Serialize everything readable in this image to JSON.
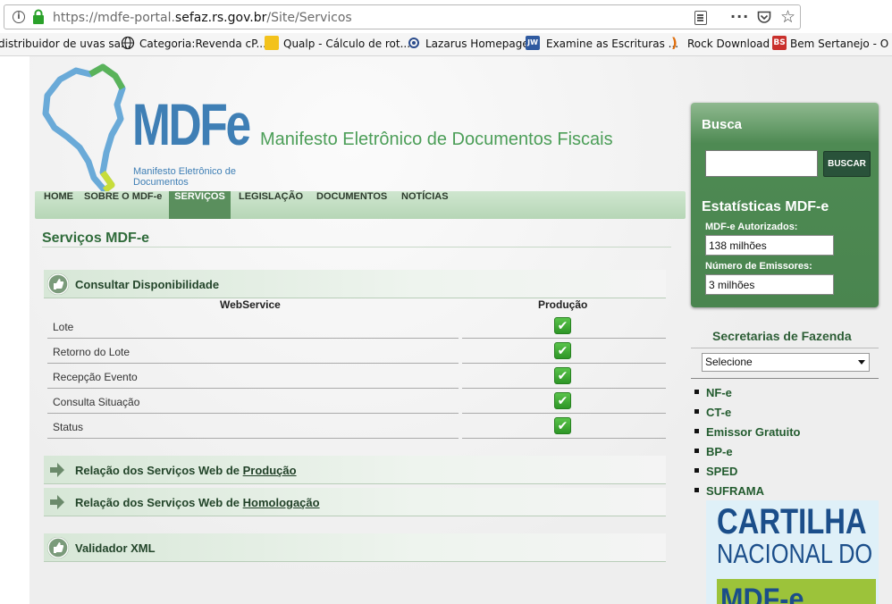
{
  "browser": {
    "url_scheme": "https://mdfe-portal.",
    "url_host": "sefaz.rs.gov.br",
    "url_path": "/Site/Servicos",
    "bookmarks": [
      {
        "label": "distribuidor de uvas sa..."
      },
      {
        "label": "Categoria:Revenda cP..."
      },
      {
        "label": "Qualp - Cálculo de rot..."
      },
      {
        "label": "Lazarus Homepage"
      },
      {
        "label": "Examine as Escrituras ..."
      },
      {
        "label": "Rock Download"
      },
      {
        "label": "Bem Sertanejo - O Me"
      }
    ]
  },
  "header": {
    "logo_text": "MDFe",
    "logo_subtitle": "Manifesto Eletrônico de Documentos",
    "site_title": "Manifesto Eletrônico de Documentos Fiscais"
  },
  "nav": {
    "items": [
      {
        "label": "HOME"
      },
      {
        "label": "SOBRE O MDF-e"
      },
      {
        "label": "SERVIÇOS"
      },
      {
        "label": "LEGISLAÇÃO"
      },
      {
        "label": "DOCUMENTOS"
      },
      {
        "label": "NOTÍCIAS"
      }
    ],
    "active": "SERVIÇOS"
  },
  "main": {
    "heading": "Serviços MDF-e",
    "availability": {
      "title": "Consultar Disponibilidade",
      "col_webservice": "WebService",
      "col_producao": "Produção",
      "rows": [
        {
          "name": "Lote",
          "status": "ok"
        },
        {
          "name": "Retorno do Lote",
          "status": "ok"
        },
        {
          "name": "Recepção Evento",
          "status": "ok"
        },
        {
          "name": "Consulta Situação",
          "status": "ok"
        },
        {
          "name": "Status",
          "status": "ok"
        }
      ]
    },
    "prod_link_prefix": "Relação dos Serviços Web de ",
    "prod_link_text": "Produção",
    "homolog_link_prefix": "Relação dos Serviços Web de ",
    "homolog_link_text": "Homologação",
    "validator_title": "Validador XML"
  },
  "sidebar": {
    "search_label": "Busca",
    "search_value": "",
    "search_button": "BUSCAR",
    "stats_title": "Estatísticas MDF-e",
    "authorized_label": "MDF-e Autorizados:",
    "authorized_value": "138 milhões",
    "emitters_label": "Número de Emissores:",
    "emitters_value": "3 milhões",
    "fazenda_title": "Secretarias de Fazenda",
    "fazenda_selected": "Selecione",
    "links": [
      {
        "label": "NF-e"
      },
      {
        "label": "CT-e"
      },
      {
        "label": "Emissor Gratuito"
      },
      {
        "label": "BP-e"
      },
      {
        "label": "SPED"
      },
      {
        "label": "SUFRAMA"
      }
    ],
    "banner_line1": "CARTILHA",
    "banner_line2": "NACIONAL DO",
    "banner_line3": "MDF-e"
  },
  "colors": {
    "brand_green": "#4c9e58",
    "brand_blue": "#3f7fb5",
    "nav_active": "#5a8f5d",
    "check_green": "#3aa82f"
  }
}
